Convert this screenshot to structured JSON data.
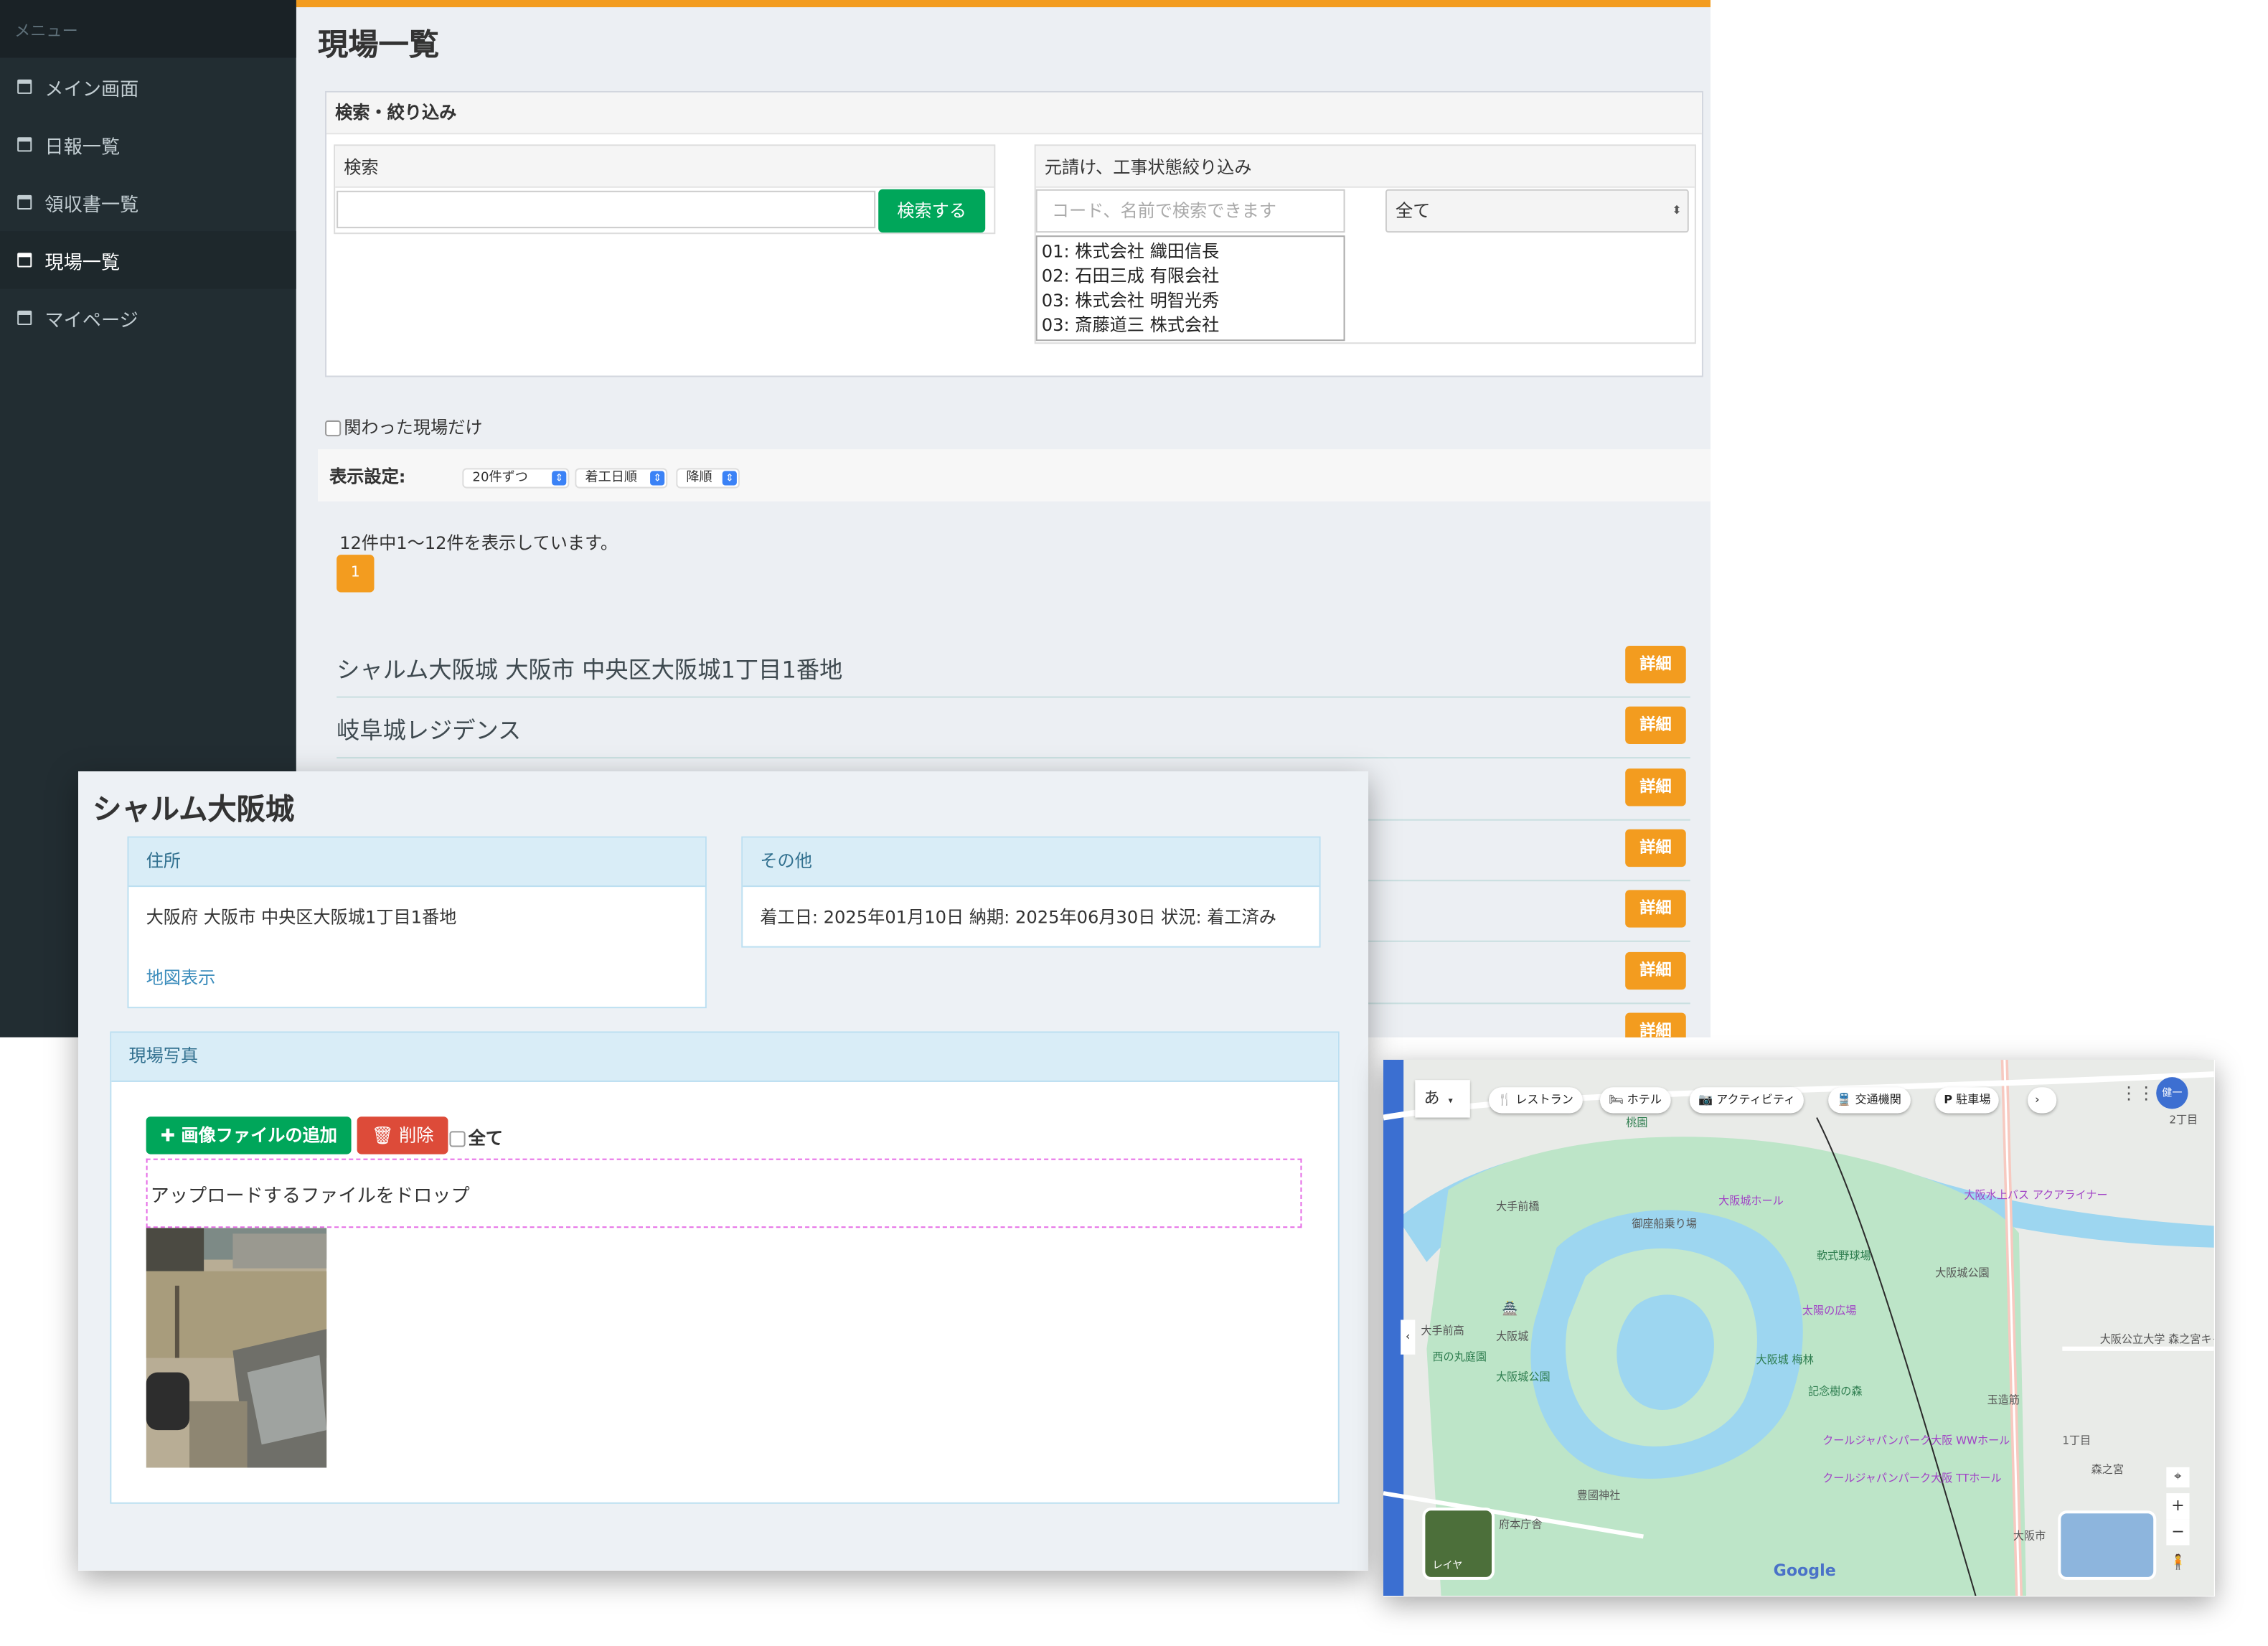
{
  "colors": {
    "accent": "#f39c1f",
    "sidebar_bg": "#222d32",
    "success": "#00a65a",
    "danger": "#dd4b39",
    "info_header": "#d9edf7",
    "link": "#3c8dbc"
  },
  "sidebar": {
    "header": "メニュー",
    "items": [
      {
        "label": "メイン画面",
        "icon": "calendar-icon"
      },
      {
        "label": "日報一覧",
        "icon": "calendar-icon"
      },
      {
        "label": "領収書一覧",
        "icon": "calendar-icon"
      },
      {
        "label": "現場一覧",
        "icon": "calendar-icon",
        "active": true
      },
      {
        "label": "マイページ",
        "icon": "calendar-icon"
      }
    ]
  },
  "page": {
    "title": "現場一覧"
  },
  "search": {
    "box_title": "検索・絞り込み",
    "keyword_label": "検索",
    "keyword_value": "",
    "search_button": "検索する",
    "filter_label": "元請け、工事状態絞り込み",
    "filter_placeholder": "コード、名前で検索できます",
    "contractors": [
      "01: 株式会社 織田信長",
      "02: 石田三成 有限会社",
      "03: 株式会社 明智光秀",
      "03: 斎藤道三 株式会社"
    ],
    "status_selected": "全て"
  },
  "filters": {
    "involved_only_label": "関わった現場だけ"
  },
  "display": {
    "label": "表示設定:",
    "per_page": "20件ずつ",
    "sort_by": "着工日順",
    "order": "降順"
  },
  "pager": {
    "info": "12件中1〜12件を表示しています。",
    "current_page": "1"
  },
  "sites": [
    {
      "name": "シャルム大阪城  大阪市 中央区大阪城1丁目1番地",
      "detail": "詳細"
    },
    {
      "name": "岐阜城レジデンス",
      "detail": "詳細"
    },
    {
      "name": "",
      "detail": "詳細"
    },
    {
      "name": "",
      "detail": "詳細"
    },
    {
      "name": "",
      "detail": "詳細"
    },
    {
      "name": "",
      "detail": "詳細"
    },
    {
      "name": "",
      "detail": "詳細"
    }
  ],
  "detail_panel": {
    "title": "シャルム大阪城",
    "address_header": "住所",
    "address": "大阪府 大阪市 中央区大阪城1丁目1番地",
    "map_link": "地図表示",
    "other_header": "その他",
    "other_text": "着工日: 2025年01月10日 納期: 2025年06月30日 状況: 着工済み",
    "photos_header": "現場写真",
    "add_image_button": "画像ファイルの追加",
    "delete_button": "削除",
    "select_all_label": "全て",
    "dropzone_text": "アップロードするファイルをドロップ"
  },
  "map": {
    "input_mode": "あ",
    "chips": [
      "レストラン",
      "ホテル",
      "アクティビティ",
      "交通機関",
      "駐車場"
    ],
    "user_initial": "健一",
    "layer_label": "レイヤ",
    "google_label": "Google",
    "places": [
      {
        "name": "大阪城",
        "color": "gray"
      },
      {
        "name": "大阪城公園",
        "color": "green"
      },
      {
        "name": "大阪城ホール",
        "color": "purple"
      },
      {
        "name": "御座船乗り場",
        "color": "gray"
      },
      {
        "name": "軟式野球場",
        "color": "green"
      },
      {
        "name": "大阪城公園",
        "color": "gray"
      },
      {
        "name": "太陽の広場",
        "color": "purple"
      },
      {
        "name": "大阪城 梅林",
        "color": "green"
      },
      {
        "name": "記念樹の森",
        "color": "green"
      },
      {
        "name": "西の丸庭園",
        "color": "green"
      },
      {
        "name": "大手前高",
        "color": "gray"
      },
      {
        "name": "豊國神社",
        "color": "gray"
      },
      {
        "name": "クールジャパンパーク大阪 WWホール",
        "color": "purple"
      },
      {
        "name": "クールジャパンパーク大阪 TTホール",
        "color": "purple"
      },
      {
        "name": "大阪水上バス アクアライナー",
        "color": "purple"
      },
      {
        "name": "大阪公立大学 森之宮キャンパス",
        "color": "gray"
      },
      {
        "name": "森之宮",
        "color": "gray"
      },
      {
        "name": "1丁目",
        "color": "gray"
      },
      {
        "name": "2丁目",
        "color": "gray"
      },
      {
        "name": "大手前橋",
        "color": "gray"
      },
      {
        "name": "玉造筋",
        "color": "gray"
      },
      {
        "name": "桃園",
        "color": "green"
      },
      {
        "name": "府本庁舎",
        "color": "gray"
      },
      {
        "name": "大阪市",
        "color": "gray"
      }
    ]
  }
}
